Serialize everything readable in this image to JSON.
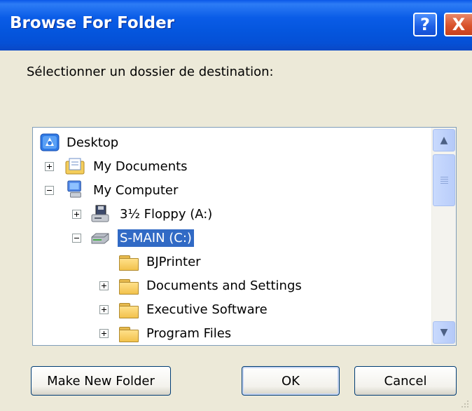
{
  "window": {
    "title": "Browse For Folder",
    "help_glyph": "?",
    "close_glyph": "X"
  },
  "prompt": "Sélectionner un dossier de destination:",
  "tree": [
    {
      "label": "Desktop",
      "icon": "desktop-icon",
      "expander": "none",
      "selected": false
    },
    {
      "label": "My Documents",
      "icon": "my-documents-icon",
      "expander": "plus",
      "selected": false
    },
    {
      "label": "My Computer",
      "icon": "my-computer-icon",
      "expander": "minus",
      "selected": false
    },
    {
      "label": "3½ Floppy (A:)",
      "icon": "floppy-drive-icon",
      "expander": "plus",
      "selected": false
    },
    {
      "label": "S-MAIN (C:)",
      "icon": "hard-drive-icon",
      "expander": "minus",
      "selected": true
    },
    {
      "label": "BJPrinter",
      "icon": "folder-icon",
      "expander": "none",
      "selected": false
    },
    {
      "label": "Documents and Settings",
      "icon": "folder-icon",
      "expander": "plus",
      "selected": false
    },
    {
      "label": "Executive Software",
      "icon": "folder-icon",
      "expander": "plus",
      "selected": false
    },
    {
      "label": "Program Files",
      "icon": "folder-icon",
      "expander": "plus",
      "selected": false
    }
  ],
  "scrollbar": {
    "up_glyph": "▲",
    "down_glyph": "▼"
  },
  "buttons": {
    "make_new_folder": "Make New Folder",
    "ok": "OK",
    "cancel": "Cancel"
  },
  "colors": {
    "titlebar": "#0556de",
    "selection": "#316ac5",
    "dialog_bg": "#ece9d8"
  }
}
